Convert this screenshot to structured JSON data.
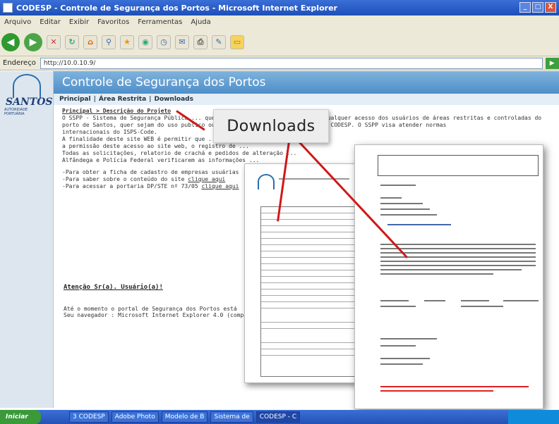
{
  "window": {
    "title": "CODESP - Controle de Segurança dos Portos - Microsoft Internet Explorer",
    "buttons": [
      "_",
      "□",
      "X"
    ]
  },
  "menu": [
    "Arquivo",
    "Editar",
    "Exibir",
    "Favoritos",
    "Ferramentas",
    "Ajuda"
  ],
  "address": {
    "label": "Endereço",
    "value": "http://10.0.10.9/"
  },
  "logo": {
    "name": "SANTOS",
    "sub": "AUTORIDADE PORTUÁRIA"
  },
  "page": {
    "header": "Controle de Segurança dos Portos",
    "nav": [
      "Principal",
      "Área Restrita",
      "Downloads"
    ],
    "breadcrumb": "Principal > Descrição do Projeto",
    "p1": "O SSPP - Sistema de Segurança Pública ... quer sejam do uso público ou ... e qualquer acesso dos usuários de áreas restritas e controladas do",
    "p2": "porto de Santos, quer sejam do uso publico ou ... os crachás padronizados pela CODESP. O SSPP visa atender normas",
    "p3": "internacionais do ISPS-Code.",
    "p4": "A finalidade deste site WEB é permitir que ... ",
    "p5": "a permissão deste acesso ao site web, o registro de ... ",
    "p6": "Todas as solicitações, relatorio de crachá e pedidos de alteração ...",
    "p7": "Alfândega e Polícia Federal verificarem as informações ...",
    "l1": "-Para obter a ficha de cadastro de empresas usuárias",
    "l2_pre": "-Para saber sobre o conteúdo do site",
    "l2_link": "clique aqui",
    "l3_pre": "-Para acessar a portaria DP/STE nº 73/05",
    "l3_link": "clique aqui",
    "attention": "Atenção Sr(a). Usuário(a)!",
    "note1": "Até o momento o portal de Segurança dos Portos está",
    "note2": "Seu navegador : Microsoft Internet Explorer 4.0 (compa"
  },
  "callout": "Downloads",
  "taskbar": {
    "start": "Iniciar",
    "tasks": [
      "3 CODESP",
      "Adobe Photo",
      "Modelo de B",
      "Sistema de",
      "CODESP - C"
    ]
  }
}
